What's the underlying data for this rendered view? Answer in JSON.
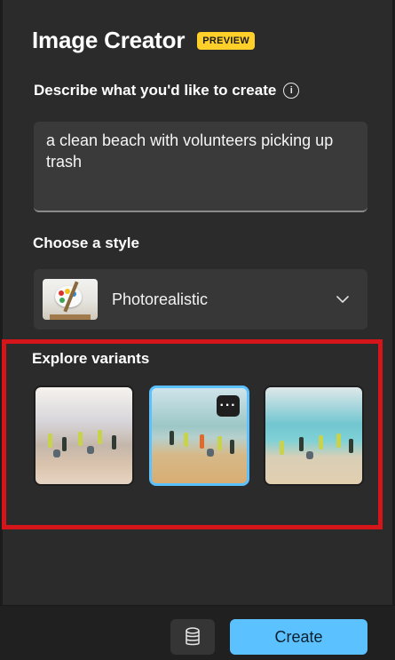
{
  "header": {
    "title": "Image Creator",
    "badge": "PREVIEW"
  },
  "prompt": {
    "label": "Describe what you'd like to create",
    "info_icon": "info-icon",
    "value": "a clean beach with volunteers picking up trash"
  },
  "style": {
    "label": "Choose a style",
    "selected": "Photorealistic",
    "thumbnail_icon": "palette-icon",
    "dropdown_icon": "chevron-down-icon"
  },
  "variants": {
    "label": "Explore variants",
    "items": [
      {
        "name": "variant-1",
        "selected": false
      },
      {
        "name": "variant-2",
        "selected": true
      },
      {
        "name": "variant-3",
        "selected": false
      }
    ],
    "more_icon": "more-icon",
    "more_glyph": "···"
  },
  "footer": {
    "credits_icon": "database-icon",
    "create_label": "Create"
  },
  "colors": {
    "background": "#2b2b2b",
    "accent": "#5cc1ff",
    "badge": "#ffd02a",
    "highlight": "#d4161b"
  }
}
